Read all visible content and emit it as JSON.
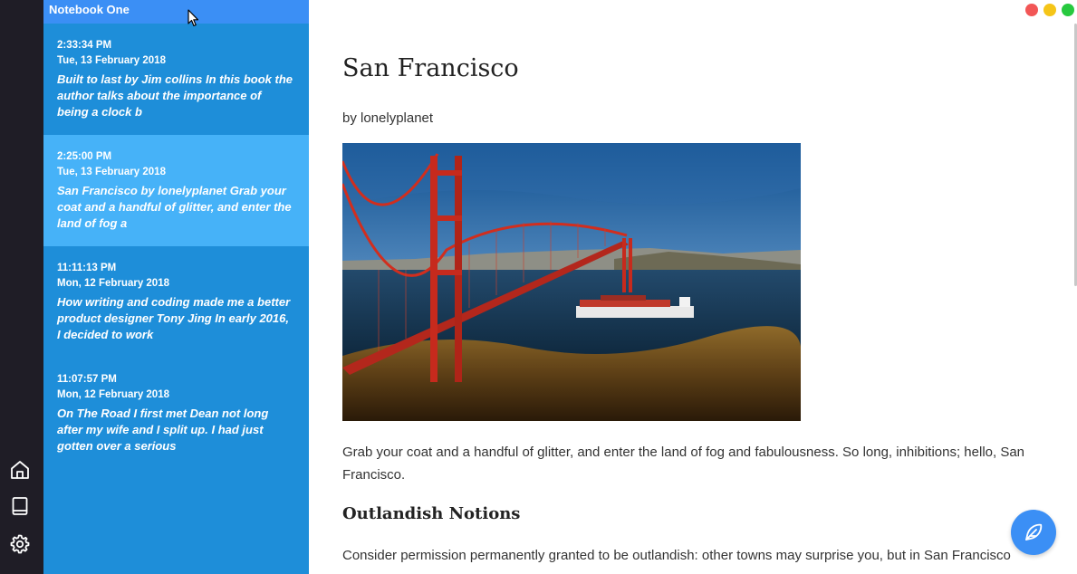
{
  "sidebar": {
    "icons": [
      "home-icon",
      "book-icon",
      "gear-icon"
    ]
  },
  "notebook": {
    "name": "Notebook One",
    "notes": [
      {
        "time": "2:33:34 PM",
        "date": "Tue, 13 February 2018",
        "preview": "Built to last by Jim collins In this book the author talks about the importance of being a clock b"
      },
      {
        "time": "2:25:00 PM",
        "date": "Tue, 13 February 2018",
        "preview": "San Francisco by lonelyplanet Grab your coat and a handful of glitter, and enter the land of fog a"
      },
      {
        "time": "11:11:13 PM",
        "date": "Mon, 12 February 2018",
        "preview": "How writing and coding made me a better product designer Tony Jing In early 2016, I decided to work"
      },
      {
        "time": "11:07:57 PM",
        "date": "Mon, 12 February 2018",
        "preview": "On The Road I first met Dean not long after my wife and I split up. I had just gotten over a serious"
      }
    ]
  },
  "document": {
    "title": "San Francisco",
    "byline": "by lonelyplanet",
    "paragraph1": "Grab your coat and a handful of glitter, and enter the land of fog and fabulousness. So long, inhibitions; hello, San Francisco.",
    "subheading": "Outlandish Notions",
    "paragraph2": "Consider permission permanently granted to be outlandish: other towns may surprise you, but in San Francisco"
  },
  "colors": {
    "rail": "#1f1d26",
    "panel": "#1e8ed9",
    "selected_note": "#46b2f8",
    "header": "#3b8ff5",
    "close": "#f25656",
    "minimize": "#f5c518",
    "maximize": "#27c93f",
    "fab": "#3b8ff5"
  },
  "window_controls": [
    "close-button",
    "minimize-button",
    "maximize-button"
  ],
  "fab": {
    "icon": "feather-icon"
  }
}
